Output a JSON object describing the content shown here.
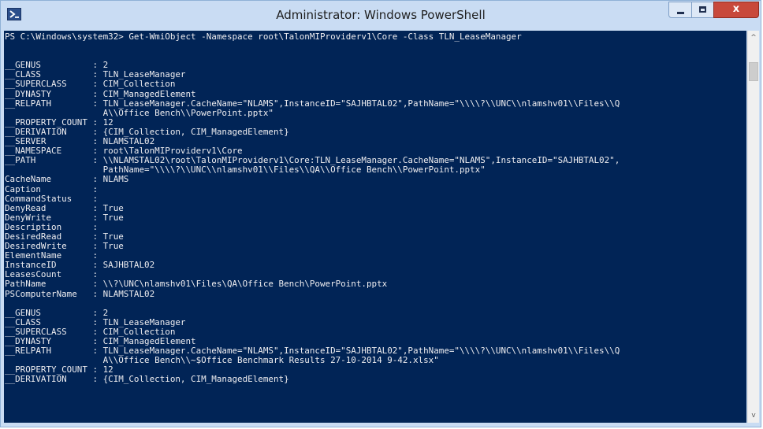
{
  "window": {
    "title": "Administrator: Windows PowerShell",
    "close_glyph": "x"
  },
  "console": {
    "text": "PS C:\\Windows\\system32> Get-WmiObject -Namespace root\\TalonMIProviderv1\\Core -Class TLN_LeaseManager\n\n\n__GENUS          : 2\n__CLASS          : TLN_LeaseManager\n__SUPERCLASS     : CIM_Collection\n__DYNASTY        : CIM_ManagedElement\n__RELPATH        : TLN_LeaseManager.CacheName=\"NLAMS\",InstanceID=\"SAJHBTAL02\",PathName=\"\\\\\\\\?\\\\UNC\\\\nlamshv01\\\\Files\\\\Q\n                   A\\\\Office Bench\\\\PowerPoint.pptx\"\n__PROPERTY_COUNT : 12\n__DERIVATION     : {CIM_Collection, CIM_ManagedElement}\n__SERVER         : NLAMSTAL02\n__NAMESPACE      : root\\TalonMIProviderv1\\Core\n__PATH           : \\\\NLAMSTAL02\\root\\TalonMIProviderv1\\Core:TLN_LeaseManager.CacheName=\"NLAMS\",InstanceID=\"SAJHBTAL02\",\n                   PathName=\"\\\\\\\\?\\\\UNC\\\\nlamshv01\\\\Files\\\\QA\\\\Office Bench\\\\PowerPoint.pptx\"\nCacheName        : NLAMS\nCaption          :\nCommandStatus    :\nDenyRead         : True\nDenyWrite        : True\nDescription      :\nDesiredRead      : True\nDesiredWrite     : True\nElementName      :\nInstanceID       : SAJHBTAL02\nLeasesCount      :\nPathName         : \\\\?\\UNC\\nlamshv01\\Files\\QA\\Office Bench\\PowerPoint.pptx\nPSComputerName   : NLAMSTAL02\n\n__GENUS          : 2\n__CLASS          : TLN_LeaseManager\n__SUPERCLASS     : CIM_Collection\n__DYNASTY        : CIM_ManagedElement\n__RELPATH        : TLN_LeaseManager.CacheName=\"NLAMS\",InstanceID=\"SAJHBTAL02\",PathName=\"\\\\\\\\?\\\\UNC\\\\nlamshv01\\\\Files\\\\Q\n                   A\\\\Office Bench\\\\~$Office Benchmark Results 27-10-2014 9-42.xlsx\"\n__PROPERTY_COUNT : 12\n__DERIVATION     : {CIM_Collection, CIM_ManagedElement}"
  },
  "scrollbar": {
    "up_arrow": "^",
    "down_arrow": "v"
  }
}
